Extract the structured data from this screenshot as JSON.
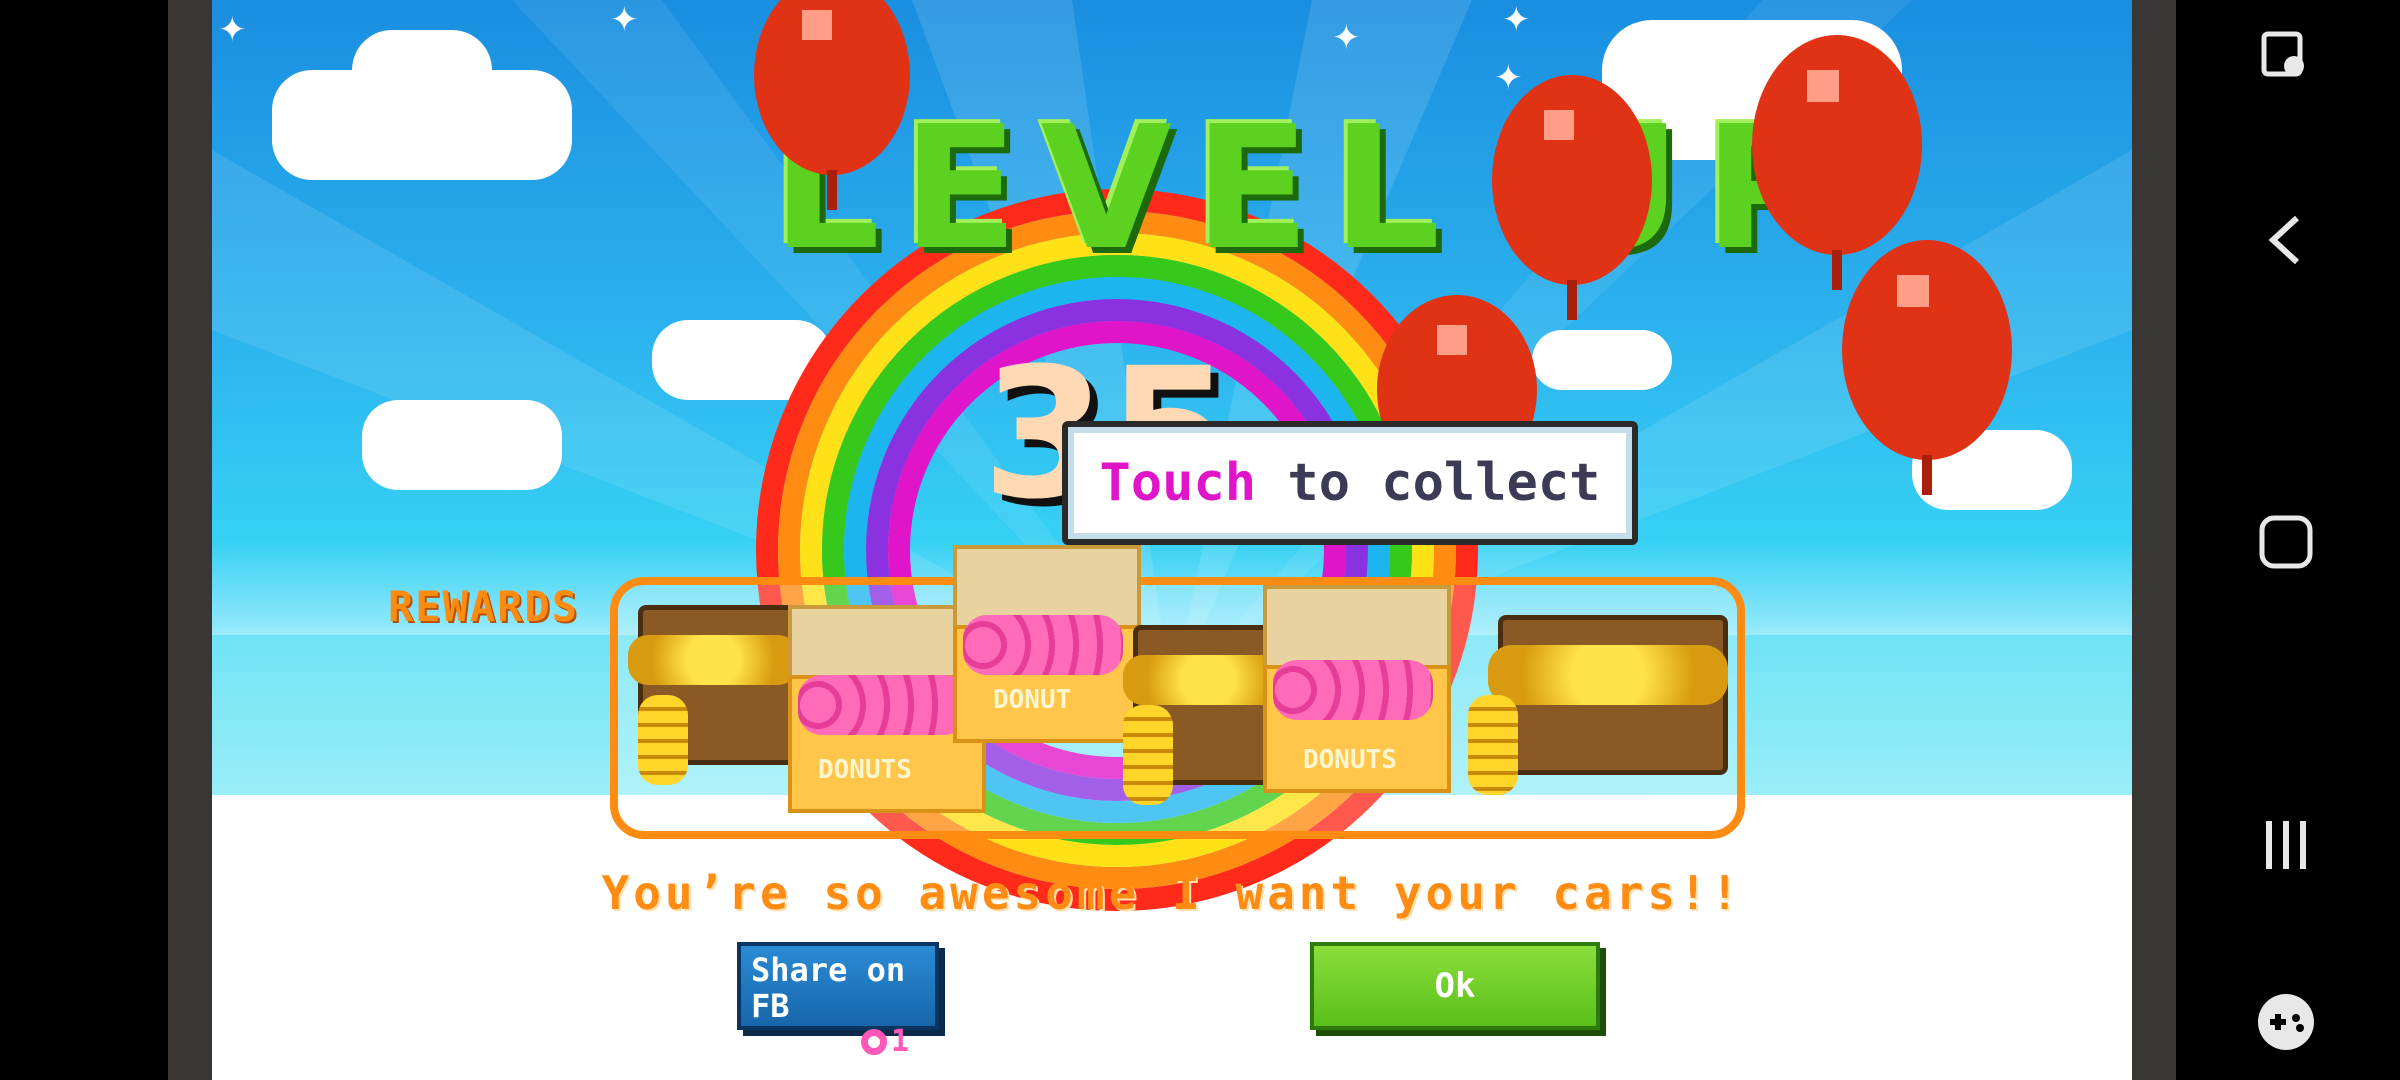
{
  "game": {
    "title": "LEVEL UP",
    "level": "35",
    "rewards_label": "REWARDS",
    "tooltip": {
      "highlight": "Touch",
      "rest": " to collect"
    },
    "message": "You’re so awesome I want your cars!!",
    "rewards": [
      {
        "type": "coin-chest"
      },
      {
        "type": "donut-box",
        "label": "DONUTS"
      },
      {
        "type": "donut-box",
        "label": "DONUT"
      },
      {
        "type": "coin-chest"
      },
      {
        "type": "donut-box",
        "label": "DONUTS"
      },
      {
        "type": "coin-chest"
      }
    ],
    "buttons": {
      "share_label": "Share on FB",
      "share_cost": "1",
      "ok_label": "Ok"
    },
    "colors": {
      "accent": "#ff8c12",
      "ok_green": "#6fcf24",
      "fb_blue": "#1e76c0",
      "balloon_red": "#e03214",
      "title_green": "#5cd11f"
    }
  },
  "navbar": {
    "icons": [
      "screen-touch-icon",
      "back-icon",
      "home-icon",
      "recents-icon",
      "game-controller-icon"
    ]
  }
}
